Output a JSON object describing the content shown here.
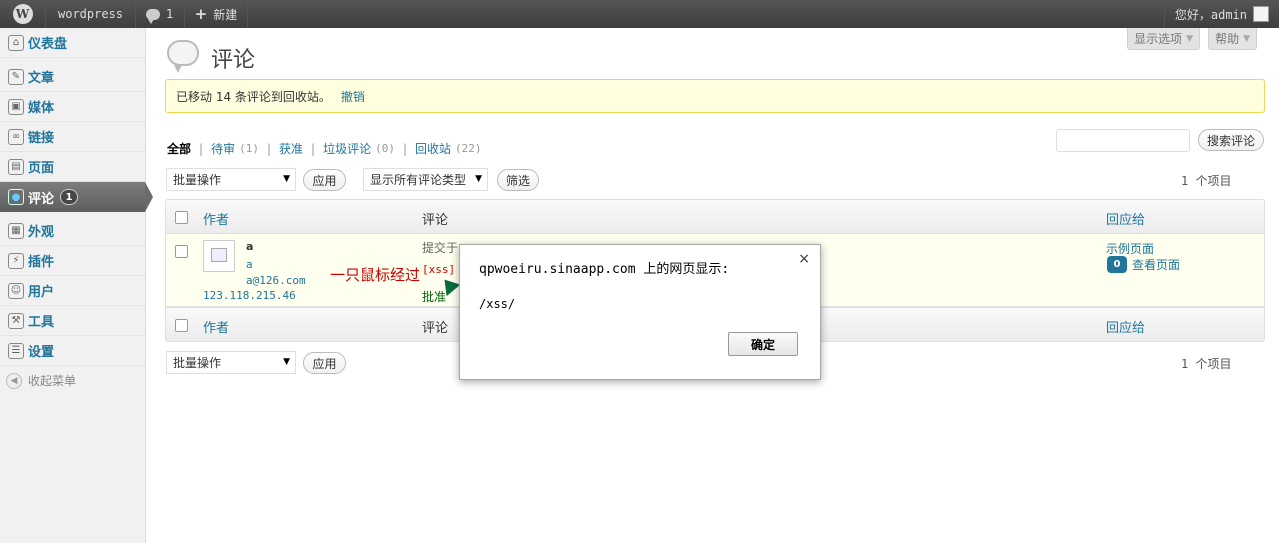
{
  "admin_bar": {
    "site_name": "wordpress",
    "comments_count": "1",
    "new_label": "新建",
    "greeting": "您好，admin"
  },
  "sidebar": {
    "items": [
      {
        "label": "仪表盘",
        "icon": "dashboard-icon"
      },
      {
        "label": "文章",
        "icon": "pin-icon"
      },
      {
        "label": "媒体",
        "icon": "media-icon"
      },
      {
        "label": "链接",
        "icon": "link-icon"
      },
      {
        "label": "页面",
        "icon": "page-icon"
      },
      {
        "label": "评论",
        "icon": "comment-icon",
        "badge": "1"
      },
      {
        "label": "外观",
        "icon": "appearance-icon"
      },
      {
        "label": "插件",
        "icon": "plugin-icon"
      },
      {
        "label": "用户",
        "icon": "users-icon"
      },
      {
        "label": "工具",
        "icon": "tools-icon"
      },
      {
        "label": "设置",
        "icon": "settings-icon"
      }
    ],
    "collapse_label": "收起菜单"
  },
  "screen_options": "显示选项",
  "help": "帮助",
  "page_title": "评论",
  "notice": {
    "text": "已移动 14 条评论到回收站。",
    "undo": "撤销"
  },
  "filters": {
    "all": "全部",
    "pending": "待审",
    "pending_count": "(1)",
    "approved": "获准",
    "spam": "垃圾评论",
    "spam_count": "(0)",
    "trash": "回收站",
    "trash_count": "(22)"
  },
  "search_button": "搜索评论",
  "bulk_actions": "批量操作",
  "apply": "应用",
  "type_filter": "显示所有评论类型",
  "filter_button": "筛选",
  "items_count": "1 个项目",
  "table": {
    "col_author": "作者",
    "col_comment": "评论",
    "col_response": "回应给"
  },
  "comment_row": {
    "author": "a",
    "author_url": "a",
    "author_email": "a@126.com",
    "author_ip": "123.118.215.46",
    "submitted": "提交于",
    "body": "[xss]",
    "approve": "批准",
    "response_post": "示例页面",
    "post_comment_count": "0",
    "view_post": "查看页面"
  },
  "annotation": "一只鼠标经过",
  "dialog": {
    "title": "qpwoeiru.sinaapp.com 上的网页显示:",
    "close": "×",
    "message": "/xss/",
    "ok": "确定"
  },
  "colors": {
    "link": "#21759b",
    "notice_bg": "#ffffe0",
    "annotation": "#cc0000"
  }
}
